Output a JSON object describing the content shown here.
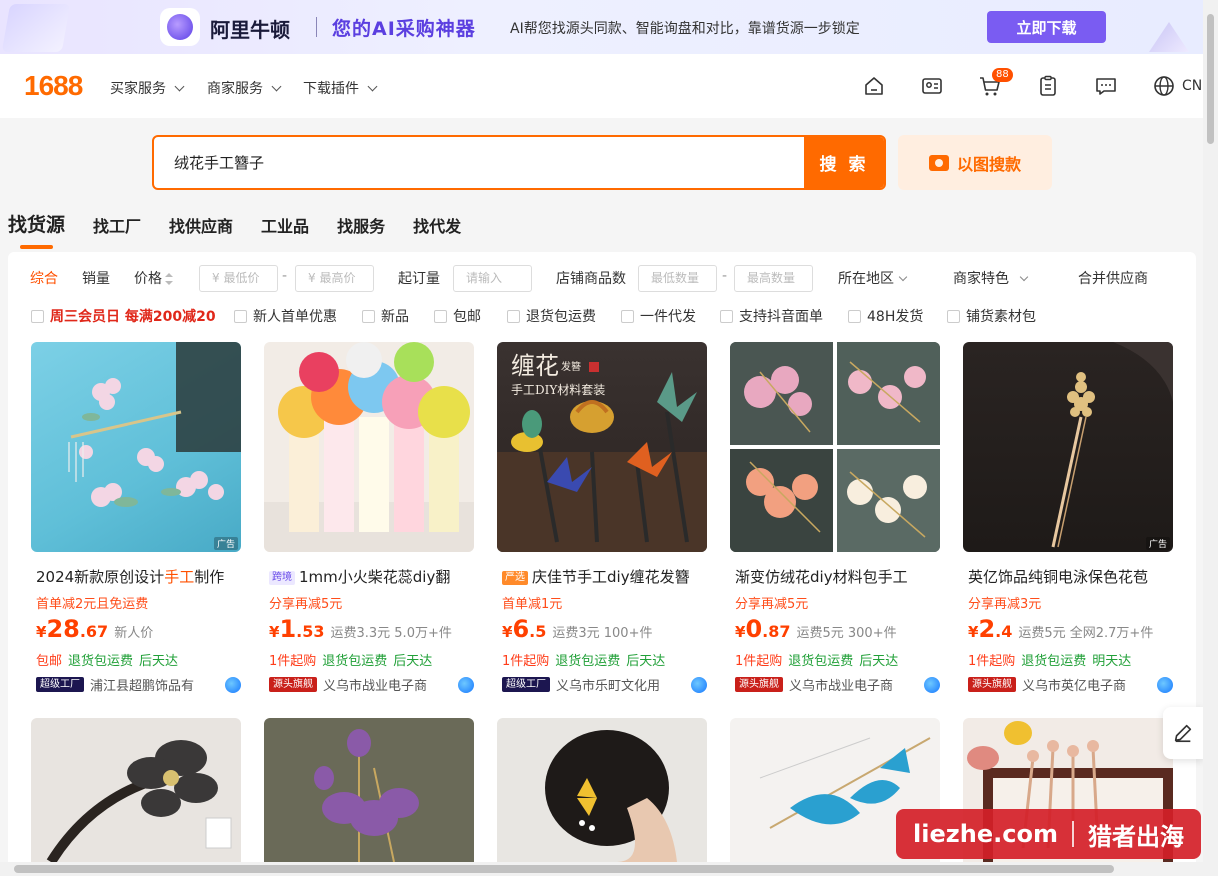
{
  "banner": {
    "brand": "阿里牛顿",
    "slogan": "您的AI采购神器",
    "description": "AI帮您找源头同款、智能询盘和对比，靠谱货源一步锁定",
    "download_label": "立即下载"
  },
  "header": {
    "logo": "1688",
    "nav": [
      "买家服务",
      "商家服务",
      "下载插件"
    ],
    "cart_count": "88",
    "lang": "CN",
    "icons": [
      "home-icon",
      "workbench-icon",
      "cart-icon",
      "orders-icon",
      "message-icon",
      "globe-icon"
    ]
  },
  "search": {
    "value": "绒花手工簪子",
    "button_label": "搜 索",
    "image_search_label": "以图搜款"
  },
  "tabs": [
    "找货源",
    "找工厂",
    "找供应商",
    "工业品",
    "找服务",
    "找代发"
  ],
  "filters": {
    "sort_default": "综合",
    "sort_sales": "销量",
    "sort_price": "价格",
    "price_min_placeholder": "¥ 最低价",
    "price_max_placeholder": "¥ 最高价",
    "moq_label": "起订量",
    "moq_placeholder": "请输入",
    "store_count_label": "店铺商品数",
    "store_min_placeholder": "最低数量",
    "store_max_placeholder": "最高数量",
    "region_label": "所在地区",
    "feature_label": "商家特色",
    "merge_label": "合并供应商",
    "dash": "-"
  },
  "checks": [
    "周三会员日 每满200减20",
    "新人首单优惠",
    "新品",
    "包邮",
    "退货包运费",
    "一件代发",
    "支持抖音面单",
    "48H发货",
    "铺货素材包"
  ],
  "products": [
    {
      "title_pre": "2024新款原创设计",
      "title_hl": "手工",
      "title_post": "制作",
      "chip": "",
      "promo": "首单减2元且免运费",
      "price_int": "28",
      "price_dec": ".67",
      "meta": "新人价",
      "svc": [
        [
          "red",
          "包邮"
        ],
        [
          "green",
          "退货包运费"
        ],
        [
          "green",
          "后天达"
        ]
      ],
      "badge_type": "factory",
      "badge": "超级工厂",
      "shop": "浦江县超鹏饰品有",
      "ad": "广告"
    },
    {
      "title_pre": "1mm小火柴花蕊diy翻",
      "title_hl": "",
      "title_post": "",
      "chip": "跨境",
      "chip_type": "cross",
      "promo": "分享再减5元",
      "price_int": "1",
      "price_dec": ".53",
      "meta": "运费3.3元  5.0万+件",
      "svc": [
        [
          "red",
          "1件起购"
        ],
        [
          "green",
          "退货包运费"
        ],
        [
          "green",
          "后天达"
        ]
      ],
      "badge_type": "source",
      "badge": "源头旗舰",
      "shop": "义乌市战业电子商",
      "ad": ""
    },
    {
      "title_pre": "庆佳节手工diy缠花发簪",
      "title_hl": "",
      "title_post": "",
      "chip": "严选",
      "chip_type": "strict",
      "promo": "首单减1元",
      "price_int": "6",
      "price_dec": ".5",
      "meta": "运费3元  100+件",
      "svc": [
        [
          "red",
          "1件起购"
        ],
        [
          "green",
          "退货包运费"
        ],
        [
          "green",
          "后天达"
        ]
      ],
      "badge_type": "factory",
      "badge": "超级工厂",
      "shop": "义乌市乐町文化用",
      "ad": ""
    },
    {
      "title_pre": "渐变仿绒花diy材料包手工",
      "title_hl": "",
      "title_post": "",
      "chip": "",
      "promo": "分享再减5元",
      "price_int": "0",
      "price_dec": ".87",
      "meta": "运费5元  300+件",
      "svc": [
        [
          "red",
          "1件起购"
        ],
        [
          "green",
          "退货包运费"
        ],
        [
          "green",
          "后天达"
        ]
      ],
      "badge_type": "source",
      "badge": "源头旗舰",
      "shop": "义乌市战业电子商",
      "ad": ""
    },
    {
      "title_pre": "英亿饰品纯铜电泳保色花苞",
      "title_hl": "",
      "title_post": "",
      "chip": "",
      "promo": "分享再减3元",
      "price_int": "2",
      "price_dec": ".4",
      "meta": "运费5元  全网2.7万+件",
      "svc": [
        [
          "red",
          "1件起购"
        ],
        [
          "green",
          "退货包运费"
        ],
        [
          "green",
          "明天达"
        ]
      ],
      "badge_type": "source",
      "badge": "源头旗舰",
      "shop": "义乌市英亿电子商",
      "ad": "广告"
    }
  ],
  "currency": "¥",
  "watermark": {
    "left": "liezhe.com",
    "right": "猎者出海"
  },
  "thumb_texts": {
    "card3_title": "缠花",
    "card3_sub": "手工DIY材料套装",
    "card3_small": "发簪"
  }
}
